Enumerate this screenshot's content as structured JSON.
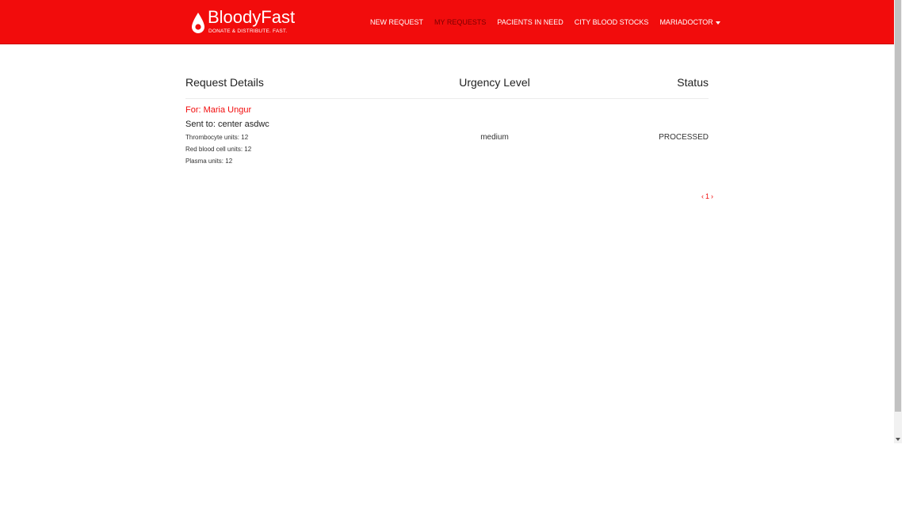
{
  "brand": {
    "name": "BloodyFast",
    "tagline": "DONATE & DISTRIBUTE. FAST."
  },
  "nav": {
    "items": [
      {
        "label": "NEW REQUEST"
      },
      {
        "label": "MY REQUESTS",
        "active": true
      },
      {
        "label": "PACIENTS IN NEED"
      },
      {
        "label": "CITY BLOOD STOCKS"
      },
      {
        "label": "MARIADOCTOR"
      }
    ]
  },
  "table": {
    "headers": {
      "details": "Request Details",
      "urgency": "Urgency Level",
      "status": "Status"
    },
    "rows": [
      {
        "for": "For: Maria Ungur",
        "sent_to": "Sent to: center asdwc",
        "thrombocyte": "Thrombocyte units: 12",
        "red_blood_cell": "Red blood cell units: 12",
        "plasma": "Plasma units: 12",
        "urgency": "medium",
        "status": "PROCESSED"
      }
    ]
  },
  "pager": {
    "prev": "‹",
    "current": "1",
    "next": "›"
  },
  "colors": {
    "brand_red": "#f20c0c",
    "nav_active": "#7a0000"
  }
}
